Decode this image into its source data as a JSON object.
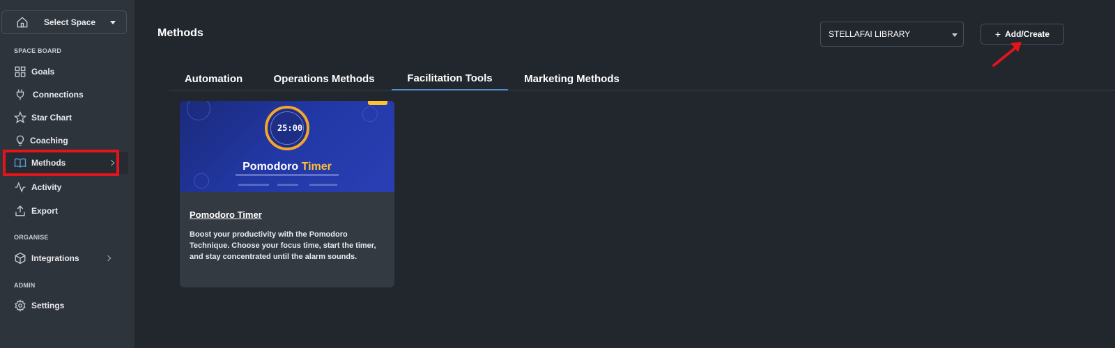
{
  "sidebar": {
    "space_select": {
      "label": "Select Space"
    },
    "sections": {
      "space_board": "SPACE BOARD",
      "organise": "ORGANISE",
      "admin": "ADMIN"
    },
    "items": [
      {
        "label": "Goals",
        "icon": "grid-icon"
      },
      {
        "label": "Connections",
        "icon": "plug-icon"
      },
      {
        "label": "Star Chart",
        "icon": "star-icon"
      },
      {
        "label": "Coaching",
        "icon": "lightbulb-icon"
      },
      {
        "label": "Methods",
        "icon": "book-icon",
        "active": true
      },
      {
        "label": "Activity",
        "icon": "activity-icon"
      },
      {
        "label": "Export",
        "icon": "export-icon"
      },
      {
        "label": "Integrations",
        "icon": "cube-icon"
      },
      {
        "label": "Settings",
        "icon": "gear-icon"
      }
    ]
  },
  "header": {
    "title": "Methods",
    "library_select": "STELLAFAI LIBRARY",
    "add_button": "Add/Create"
  },
  "tabs": [
    {
      "label": "Automation"
    },
    {
      "label": "Operations Methods"
    },
    {
      "label": "Facilitation Tools",
      "active": true
    },
    {
      "label": "Marketing Methods"
    }
  ],
  "card": {
    "thumbnail": {
      "time": "25:00",
      "title_main": "Pomodoro",
      "title_accent": "Timer"
    },
    "title": "Pomodoro Timer",
    "description": "Boost your productivity with the Pomodoro Technique. Choose your focus time, start the timer, and stay concentrated until the alarm sounds."
  },
  "colors": {
    "accent_tab": "#4f8ec9",
    "highlight": "#e3141b",
    "timer_ring": "#f4a52c",
    "timer_accent": "#ffc233"
  }
}
